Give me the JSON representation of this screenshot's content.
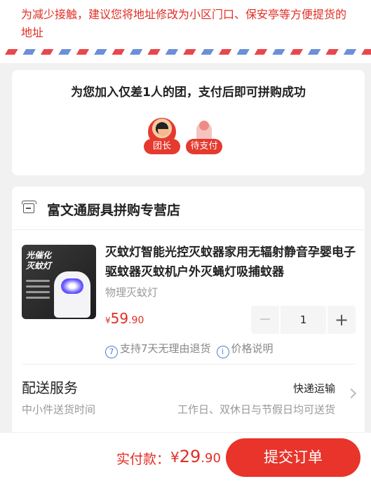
{
  "notice": {
    "text": "为减少接触，建议您将地址修改为小区门口、保安亭等方便提货的地址"
  },
  "group": {
    "title": "为您加入仅差1人的团，支付后即可拼购成功",
    "members": [
      {
        "tag": "团长"
      },
      {
        "tag": "待支付"
      }
    ]
  },
  "store": {
    "name": "富文通厨具拼购专营店"
  },
  "product": {
    "image_text_line1": "光催化",
    "image_text_line2": "灭蚊灯",
    "title": "灭蚊灯智能光控灭蚊器家用无辐射静音孕婴电子驱蚊器灭蚊机户外灭蝇灯吸捕蚊器",
    "spec": "物理灭蚊灯",
    "price": {
      "currency": "¥",
      "integer": "59",
      "decimal": ".90"
    },
    "quantity": "1",
    "minus_label": "−",
    "plus_label": "+",
    "guarantee_badge": "7",
    "guarantee_text": "支持7天无理由退货",
    "price_note_badge": "i",
    "price_note_text": "价格说明"
  },
  "delivery": {
    "title": "配送服务",
    "subtitle": "中小件送货时间",
    "method": "快递运输",
    "days": "工作日、双休日与节假日均可送货"
  },
  "checkout": {
    "label": "实付款：",
    "currency": "¥",
    "integer": "29",
    "decimal": ".90",
    "submit_label": "提交订单"
  },
  "colors": {
    "accent": "#e02e24",
    "button": "#e8342a",
    "info_blue": "#4f7fd6"
  }
}
